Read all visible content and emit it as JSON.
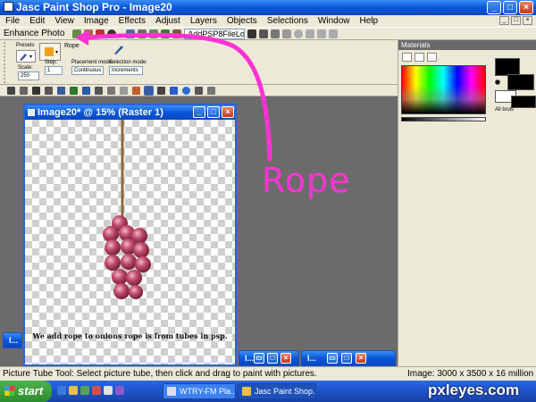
{
  "window": {
    "title": "Jasc Paint Shop Pro - Image20"
  },
  "menu": [
    "File",
    "Edit",
    "View",
    "Image",
    "Effects",
    "Adjust",
    "Layers",
    "Objects",
    "Selections",
    "Window",
    "Help"
  ],
  "toolbar": {
    "enhance_label": "Enhance Photo",
    "script_combo": "AddPSP8FileLo..."
  },
  "tool_options": {
    "presets_label": "Presets",
    "tube_name": "Rope",
    "scale_label": "Scale:",
    "scale_value": "250",
    "step_label": "Step:",
    "step_value": "1",
    "placement_label": "Placement mode:",
    "placement_value": "Continuous",
    "selection_label": "Selection mode:",
    "selection_value": "Increments"
  },
  "document": {
    "title": "Image20* @  15% (Raster 1)",
    "caption": "We add rope to onions rope is from tubes in psp."
  },
  "minimized_windows": [
    {
      "title": "I..."
    },
    {
      "title": "I..."
    },
    {
      "title": "I..."
    }
  ],
  "annotation": {
    "label": "Rope",
    "color": "#ff33d4"
  },
  "materials": {
    "title": "Materials",
    "all_tools_label": "All tools"
  },
  "status": {
    "message": "Picture Tube Tool: Select picture tube, then click and drag to paint with pictures.",
    "image_info": "Image:  3000 x 3500 x 16 million"
  },
  "taskbar": {
    "start_label": "start",
    "tasks": [
      {
        "label": "WTRY-FM Pla...",
        "active": false
      },
      {
        "label": "Jasc Paint Shop...",
        "active": true
      }
    ]
  },
  "watermark": "pxleyes.com",
  "colors": {
    "title_blue": "#0a55d8",
    "chrome": "#ece9d8",
    "workspace": "#6b6b6b",
    "onion": "#b03a5b",
    "rope": "#8a6a3a"
  }
}
